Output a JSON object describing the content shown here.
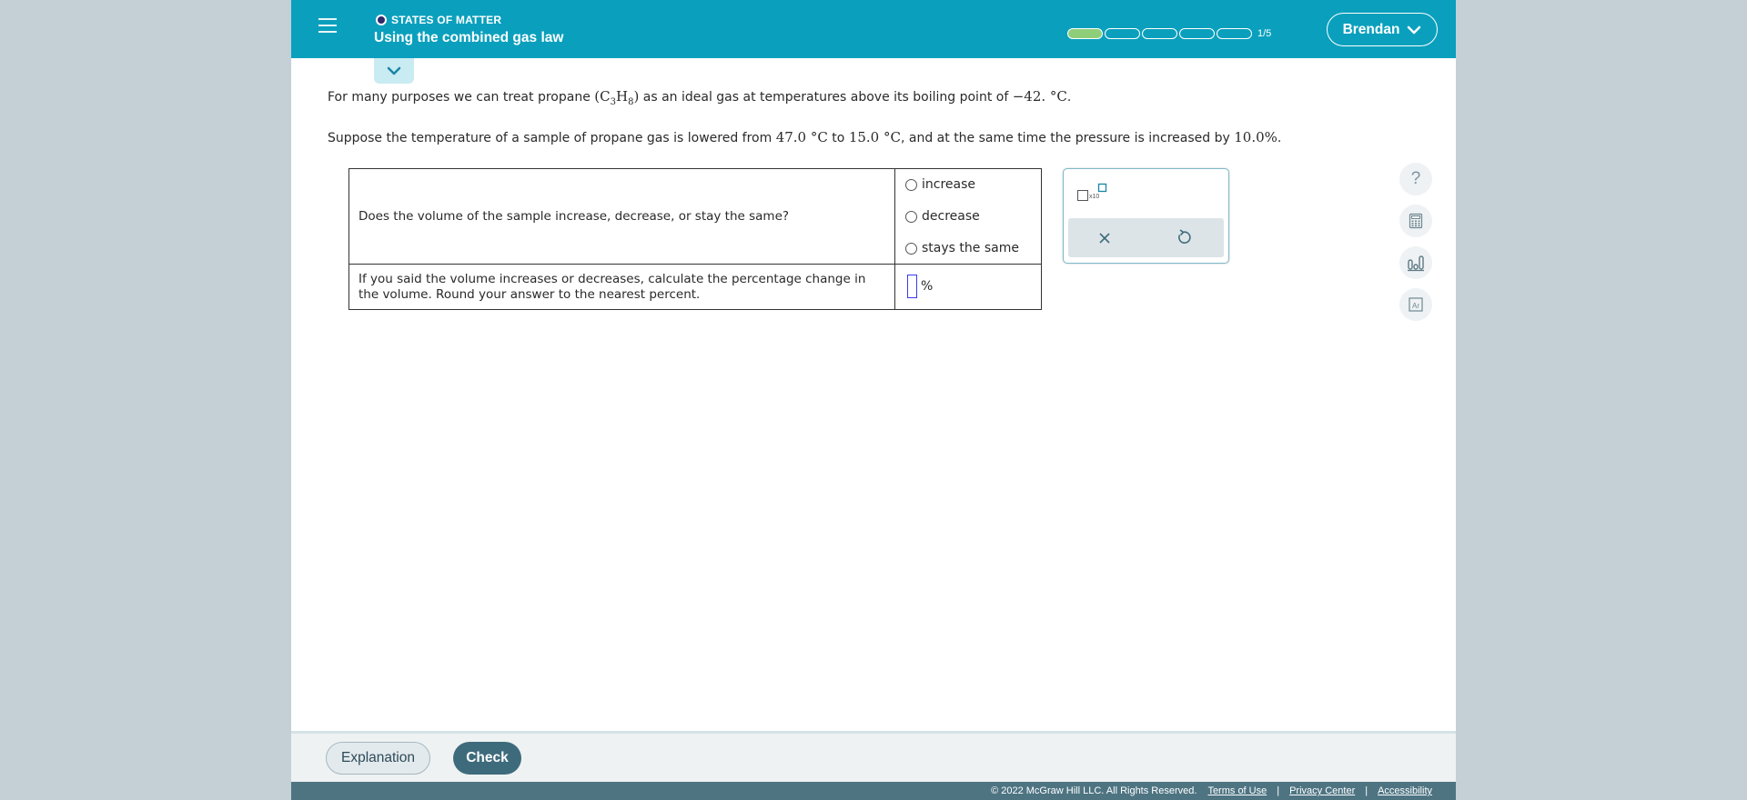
{
  "header": {
    "topic": "STATES OF MATTER",
    "title": "Using the combined gas law",
    "progress": {
      "completed": 1,
      "total": 5,
      "label": "1/5"
    },
    "user": "Brendan",
    "accent_color": "#0aa0bd"
  },
  "question": {
    "line1": {
      "pre": "For many purposes we can treat propane ",
      "formula_open": "(C",
      "sub1": "3",
      "H": "H",
      "sub2": "8",
      "formula_close": ")",
      "mid": " as an ideal gas at temperatures above its boiling point of ",
      "boiling_point": "−42. °C",
      "end": "."
    },
    "line2": {
      "pre": "Suppose the temperature of a sample of propane gas is lowered from ",
      "t1": "47.0 °C",
      "to": " to ",
      "t2": "15.0 °C",
      "mid": ", and at the same time the pressure is increased by ",
      "pct": "10.0%",
      "end": "."
    }
  },
  "table": {
    "row1_question": "Does the volume of the sample increase, decrease, or stay the same?",
    "options": [
      "increase",
      "decrease",
      "stays the same"
    ],
    "row2_question": "If you said the volume increases or decreases, calculate the percentage change in the volume. Round your answer to the nearest percent.",
    "row2_unit": "%"
  },
  "palette": {
    "x10_label": "x10",
    "clear": "clear-icon",
    "undo": "undo-icon"
  },
  "tools": [
    "help-icon",
    "calculator-icon",
    "chart-icon",
    "periodic-table-icon"
  ],
  "tool_help_glyph": "?",
  "footer": {
    "explanation": "Explanation",
    "check": "Check",
    "copyright": "© 2022 McGraw Hill LLC. All Rights Reserved.",
    "links": [
      "Terms of Use",
      "Privacy Center",
      "Accessibility"
    ],
    "separator": "|"
  }
}
